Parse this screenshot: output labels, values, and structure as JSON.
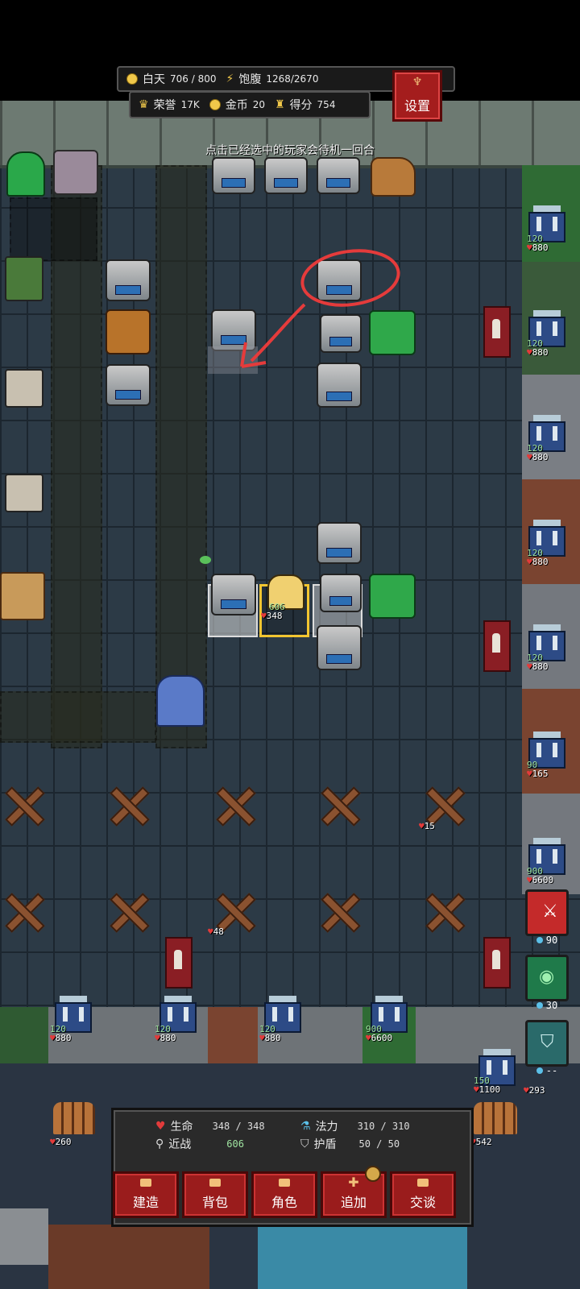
{
  "hud": {
    "daytime_label": "白天",
    "daytime_value": "706 / 800",
    "satiety_label": "饱腹",
    "satiety_value": "1268/2670",
    "honor_label": "荣誉",
    "honor_value": "17K",
    "gold_label": "金币",
    "gold_value": "20",
    "score_label": "得分",
    "score_value": "754",
    "settings_label": "设置"
  },
  "hint": "点击已经选中的玩家会待机一回合",
  "player": {
    "attack": "606",
    "hp": "348"
  },
  "right_towers": [
    {
      "atk": "120",
      "hp": "880"
    },
    {
      "atk": "120",
      "hp": "880"
    },
    {
      "atk": "120",
      "hp": "880"
    },
    {
      "atk": "120",
      "hp": "880"
    },
    {
      "atk": "120",
      "hp": "880"
    },
    {
      "atk": "90",
      "hp": "165"
    },
    {
      "atk": "900",
      "hp": "6600"
    }
  ],
  "bottom_towers": [
    {
      "atk": "120",
      "hp": "880"
    },
    {
      "atk": "120",
      "hp": "880"
    },
    {
      "atk": "120",
      "hp": "880"
    },
    {
      "atk": "900",
      "hp": "6600"
    },
    {
      "atk": "150",
      "hp": "1100"
    }
  ],
  "misc_stats": {
    "spike_hp_right": "15",
    "spike_hp_left": "48",
    "fence_left_hp": "260",
    "fence_right_hp": "542",
    "tower_extra_hp": "293"
  },
  "skills": [
    {
      "name": "sword-skill",
      "cost": "90",
      "color": "#c42a2a"
    },
    {
      "name": "eye-skill",
      "cost": "30",
      "color": "#1f7a4a"
    },
    {
      "name": "shield-skill",
      "cost": "--",
      "color": "#2a6a6a"
    }
  ],
  "status_panel": {
    "hp_label": "生命",
    "hp_value": "348 / 348",
    "mana_label": "法力",
    "mana_value": "310 / 310",
    "melee_label": "近战",
    "melee_value": "606",
    "shield_label": "护盾",
    "shield_value": "50 / 50"
  },
  "actions": {
    "build": "建造",
    "bag": "背包",
    "character": "角色",
    "add": "追加",
    "talk": "交谈"
  },
  "colors": {
    "accent_red": "#a41d1d",
    "annotation_red": "#e53b3b",
    "player_highlight": "#f2c530"
  }
}
